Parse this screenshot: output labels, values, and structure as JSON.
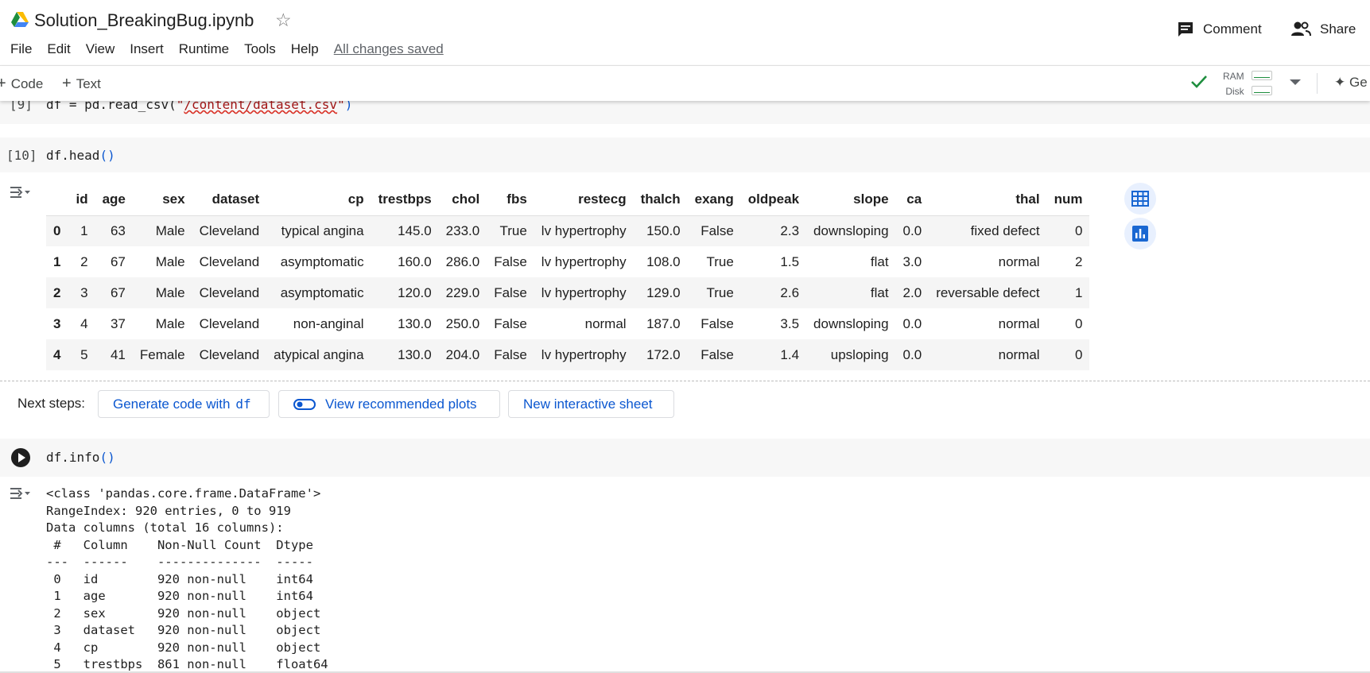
{
  "app": {
    "doc_title": "Solution_BreakingBug.ipynb",
    "menu": [
      "File",
      "Edit",
      "View",
      "Insert",
      "Runtime",
      "Tools",
      "Help"
    ],
    "save_status": "All changes saved",
    "comment_label": "Comment",
    "share_label": "Share"
  },
  "toolbar": {
    "code_label": "Code",
    "text_label": "Text",
    "ram_label": "RAM",
    "disk_label": "Disk",
    "gemini_label": "Ge"
  },
  "cells": {
    "cell9": {
      "exec": "[9]",
      "code_prefix": "df = pd.read_csv(",
      "code_quote_open": "\"",
      "code_path": "/content/dataset.csv",
      "code_quote_close": "\"",
      "code_suffix": ")"
    },
    "cell10": {
      "exec": "[10]",
      "code_prefix": "df.head",
      "code_parens": "()"
    },
    "cell11": {
      "code_prefix": "df.info",
      "code_parens": "()"
    }
  },
  "table": {
    "columns": [
      "",
      "id",
      "age",
      "sex",
      "dataset",
      "cp",
      "trestbps",
      "chol",
      "fbs",
      "restecg",
      "thalch",
      "exang",
      "oldpeak",
      "slope",
      "ca",
      "thal",
      "num"
    ],
    "rows": [
      [
        "0",
        "1",
        "63",
        "Male",
        "Cleveland",
        "typical angina",
        "145.0",
        "233.0",
        "True",
        "lv hypertrophy",
        "150.0",
        "False",
        "2.3",
        "downsloping",
        "0.0",
        "fixed defect",
        "0"
      ],
      [
        "1",
        "2",
        "67",
        "Male",
        "Cleveland",
        "asymptomatic",
        "160.0",
        "286.0",
        "False",
        "lv hypertrophy",
        "108.0",
        "True",
        "1.5",
        "flat",
        "3.0",
        "normal",
        "2"
      ],
      [
        "2",
        "3",
        "67",
        "Male",
        "Cleveland",
        "asymptomatic",
        "120.0",
        "229.0",
        "False",
        "lv hypertrophy",
        "129.0",
        "True",
        "2.6",
        "flat",
        "2.0",
        "reversable defect",
        "1"
      ],
      [
        "3",
        "4",
        "37",
        "Male",
        "Cleveland",
        "non-anginal",
        "130.0",
        "250.0",
        "False",
        "normal",
        "187.0",
        "False",
        "3.5",
        "downsloping",
        "0.0",
        "normal",
        "0"
      ],
      [
        "4",
        "5",
        "41",
        "Female",
        "Cleveland",
        "atypical angina",
        "130.0",
        "204.0",
        "False",
        "lv hypertrophy",
        "172.0",
        "False",
        "1.4",
        "upsloping",
        "0.0",
        "normal",
        "0"
      ]
    ]
  },
  "next_steps": {
    "label": "Next steps:",
    "generate_label": "Generate code with",
    "generate_var": "df",
    "plots_label": "View recommended plots",
    "sheet_label": "New interactive sheet"
  },
  "info_output": {
    "lines": [
      "<class 'pandas.core.frame.DataFrame'>",
      "RangeIndex: 920 entries, 0 to 919",
      "Data columns (total 16 columns):",
      " #   Column    Non-Null Count  Dtype  ",
      "---  ------    --------------  -----  ",
      " 0   id        920 non-null    int64  ",
      " 1   age       920 non-null    int64  ",
      " 2   sex       920 non-null    object ",
      " 3   dataset   920 non-null    object ",
      " 4   cp        920 non-null    object ",
      " 5   trestbps  861 non-null    float64"
    ]
  },
  "colors": {
    "accent": "#0b57d0",
    "check": "#1e8e3e",
    "cell_bg": "#f7f7f7"
  },
  "icons": [
    "drive-logo-icon",
    "star-icon",
    "comment-icon",
    "share-icon",
    "check-icon",
    "chevron-down-icon",
    "sparkle-icon",
    "output-toggle-icon",
    "table-icon",
    "chart-icon",
    "run-icon",
    "toggle-icon"
  ]
}
